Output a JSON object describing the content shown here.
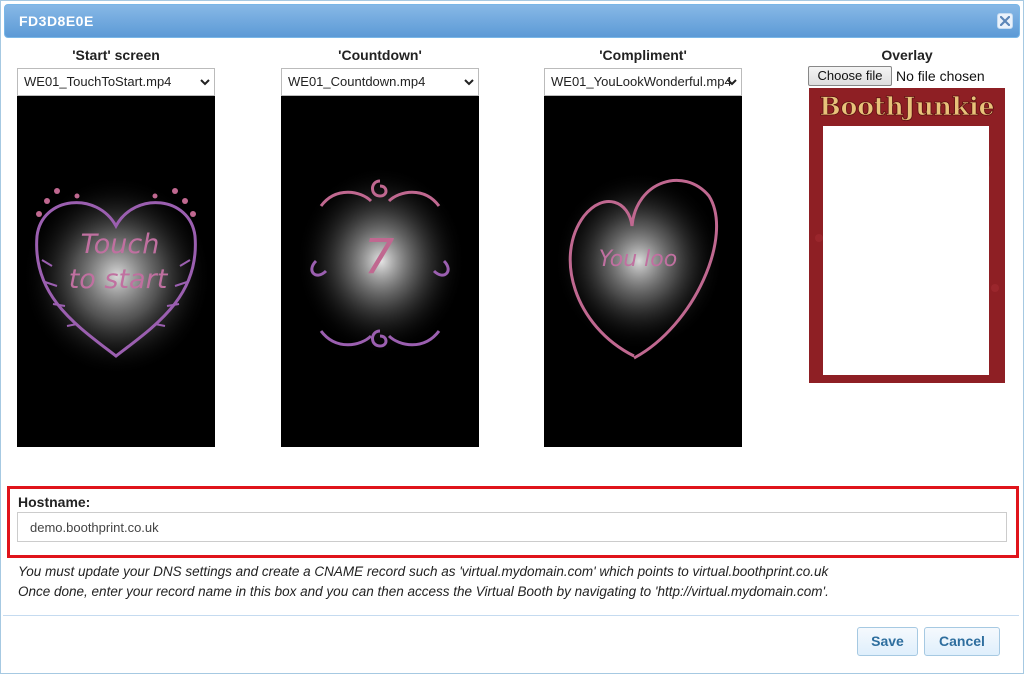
{
  "dialog": {
    "title": "FD3D8E0E"
  },
  "columns": [
    {
      "label": "'Start' screen",
      "selected": "WE01_TouchToStart.mp4",
      "preview_text": [
        "Touch",
        "to start"
      ]
    },
    {
      "label": "'Countdown'",
      "selected": "WE01_Countdown.mp4",
      "preview_text": [
        "7"
      ]
    },
    {
      "label": "'Compliment'",
      "selected": "WE01_YouLookWonderful.mp4",
      "preview_text": [
        "You loo"
      ]
    }
  ],
  "overlay": {
    "label": "Overlay",
    "choose_label": "Choose file",
    "file_status": "No file chosen",
    "logo_text": "BoothJunkie"
  },
  "hostname": {
    "label": "Hostname:",
    "value": "demo.boothprint.co.uk",
    "help_lines": [
      "You must update your DNS settings and create a CNAME record such as 'virtual.mydomain.com' which points to virtual.boothprint.co.uk",
      "Once done, enter your record name in this box and you can then access the Virtual Booth by navigating to 'http://virtual.mydomain.com'."
    ]
  },
  "buttons": {
    "save": "Save",
    "cancel": "Cancel"
  },
  "colors": {
    "titlebar": "#5c9ad6",
    "highlight_border": "#e0141b",
    "button_text": "#2e6e9e",
    "overlay_frame": "#8e1f24"
  }
}
